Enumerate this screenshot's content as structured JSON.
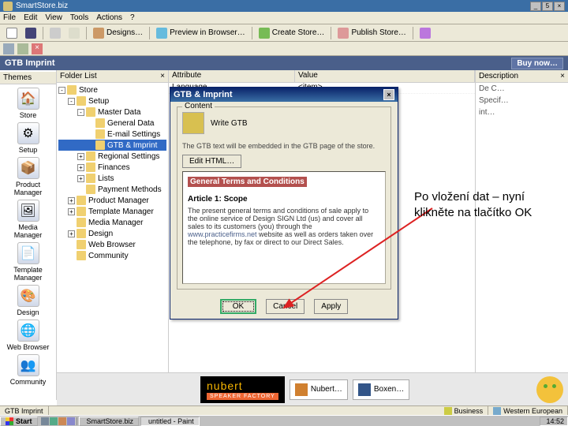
{
  "app": {
    "title": "SmartStore.biz",
    "winbuttons": [
      "_",
      "5",
      "×"
    ]
  },
  "menu": [
    "File",
    "Edit",
    "View",
    "Tools",
    "Actions",
    "?"
  ],
  "toolbar1": [
    {
      "label": "Designs…"
    },
    {
      "label": "Preview in Browser…"
    },
    {
      "label": "Create Store…"
    },
    {
      "label": "Publish Store…"
    }
  ],
  "navHeader": {
    "title": "GTB Imprint",
    "buy": "Buy now…"
  },
  "sidebarLeft": {
    "tab": "Themes",
    "items": [
      {
        "label": "Store",
        "glyph": "🏠"
      },
      {
        "label": "Setup",
        "glyph": "⚙"
      },
      {
        "label": "Product Manager",
        "glyph": "📦"
      },
      {
        "label": "Media Manager",
        "glyph": "🖼"
      },
      {
        "label": "Template Manager",
        "glyph": "📄"
      },
      {
        "label": "Design",
        "glyph": "🎨"
      },
      {
        "label": "Web Browser",
        "glyph": "🌐"
      },
      {
        "label": "Community",
        "glyph": "👥"
      }
    ]
  },
  "folderPane": {
    "header": "Folder List",
    "headerX": "×",
    "tree": [
      {
        "label": "Store",
        "indent": 0,
        "exp": "-",
        "sel": false
      },
      {
        "label": "Setup",
        "indent": 12,
        "exp": "-",
        "sel": false
      },
      {
        "label": "Master Data",
        "indent": 24,
        "exp": "-",
        "sel": false
      },
      {
        "label": "General Data",
        "indent": 36,
        "exp": "",
        "sel": false
      },
      {
        "label": "E-mail Settings",
        "indent": 36,
        "exp": "",
        "sel": false
      },
      {
        "label": "GTB & Imprint",
        "indent": 36,
        "exp": "",
        "sel": true
      },
      {
        "label": "Regional Settings",
        "indent": 24,
        "exp": "+",
        "sel": false
      },
      {
        "label": "Finances",
        "indent": 24,
        "exp": "+",
        "sel": false
      },
      {
        "label": "Lists",
        "indent": 24,
        "exp": "+",
        "sel": false
      },
      {
        "label": "Payment Methods",
        "indent": 24,
        "exp": "",
        "sel": false
      },
      {
        "label": "Product Manager",
        "indent": 12,
        "exp": "+",
        "sel": false
      },
      {
        "label": "Template Manager",
        "indent": 12,
        "exp": "+",
        "sel": false
      },
      {
        "label": "Media Manager",
        "indent": 12,
        "exp": "",
        "sel": false
      },
      {
        "label": "Design",
        "indent": 12,
        "exp": "+",
        "sel": false
      },
      {
        "label": "Web Browser",
        "indent": 12,
        "exp": "",
        "sel": false
      },
      {
        "label": "Community",
        "indent": 12,
        "exp": "",
        "sel": false
      }
    ]
  },
  "grid": {
    "cols": [
      "Attribute",
      "Value"
    ],
    "rows": [
      [
        "Language",
        "<item>"
      ]
    ]
  },
  "rightPane": {
    "header": "Description",
    "headerX": "×",
    "lines": [
      "De C…",
      "Specif…",
      "int…"
    ]
  },
  "dialog": {
    "title": "GTB & Imprint",
    "close": "×",
    "groupLabel": "Content",
    "rowLabel": "Write GTB",
    "help": "The GTB text will be embedded in the GTB page of the store.",
    "editBtn": "Edit HTML…",
    "heading": "General Terms and Conditions",
    "article": "Article 1: Scope",
    "body1": "The present general terms and conditions of sale apply to the online service of Design SIGN Ltd (us) and cover all sales to its customers (you) through the ",
    "link": "www.practicefirms.net",
    "body2": " website as well as orders taken over the telephone, by fax or direct to our Direct Sales.",
    "buttons": {
      "ok": "OK",
      "cancel": "Cancel",
      "apply": "Apply"
    }
  },
  "callout": "Po vložení dat – nyní klikněte na tlačítko OK",
  "banner": {
    "adMain": "nubert",
    "adSub": "SPEAKER FACTORY",
    "thumbs": [
      "Nubert…",
      "Boxen…"
    ]
  },
  "statusbar": {
    "left": "GTB Imprint",
    "right1": "Business",
    "right2": "Western European"
  },
  "taskbar": {
    "start": "Start",
    "items": [
      {
        "label": "SmartStore.biz",
        "active": false
      },
      {
        "label": "untitled - Paint",
        "active": true
      }
    ],
    "clock": "14:52"
  }
}
